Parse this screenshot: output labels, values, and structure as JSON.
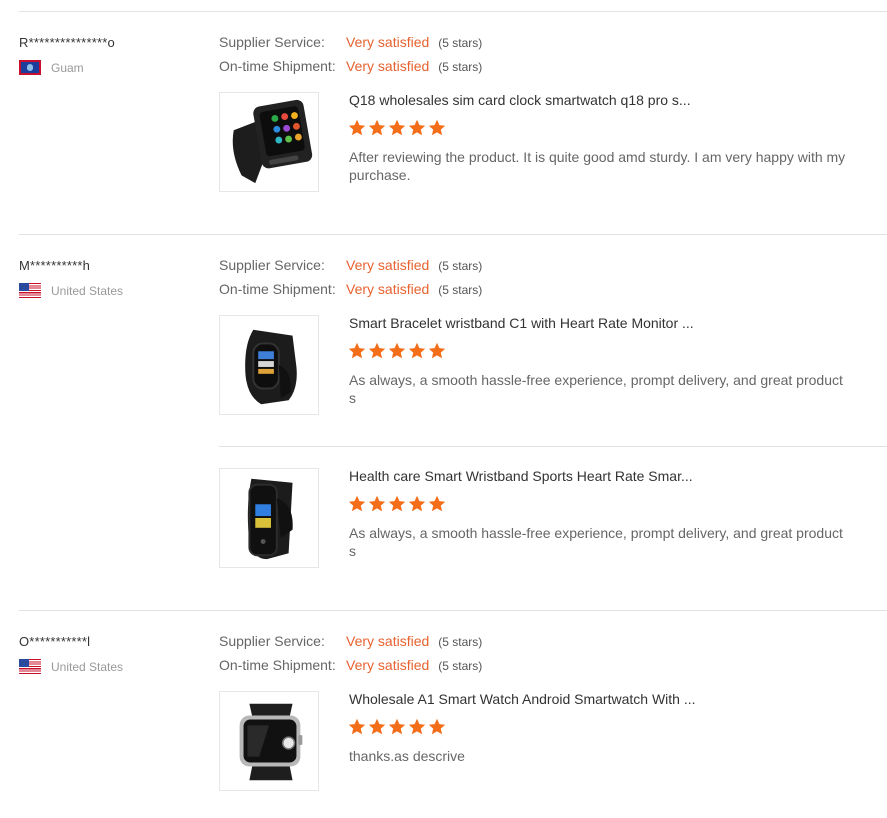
{
  "colors": {
    "accent": "#e8622f",
    "star": "#f46e1a",
    "divider": "#e2e2e2"
  },
  "labels": {
    "supplier_service": "Supplier Service:",
    "ontime_shipment": "On-time Shipment:"
  },
  "reviews": [
    {
      "buyer": "R***************o",
      "country": "Guam",
      "flag_icon": "guam-flag-icon",
      "supplier_service": {
        "value": "Very satisfied",
        "stars_text": "(5 stars)"
      },
      "ontime_shipment": {
        "value": "Very satisfied",
        "stars_text": "(5 stars)"
      },
      "items": [
        {
          "product_icon": "square-smartwatch-image",
          "title": "Q18 wholesales sim card clock smartwatch q18 pro s...",
          "rating": 5,
          "text": "After reviewing the product. It is quite good amd sturdy. I am very happy with my purchase."
        }
      ]
    },
    {
      "buyer": "M**********h",
      "country": "United States",
      "flag_icon": "us-flag-icon",
      "supplier_service": {
        "value": "Very satisfied",
        "stars_text": "(5 stars)"
      },
      "ontime_shipment": {
        "value": "Very satisfied",
        "stars_text": "(5 stars)"
      },
      "items": [
        {
          "product_icon": "fitness-band-image",
          "title": "Smart Bracelet wristband C1 with Heart Rate Monitor ...",
          "rating": 5,
          "text": "As always, a smooth hassle-free experience, prompt delivery, and great products"
        },
        {
          "product_icon": "fitness-band-image",
          "title": "Health care Smart Wristband Sports Heart Rate Smar...",
          "rating": 5,
          "text": "As always, a smooth hassle-free experience, prompt delivery, and great products"
        }
      ]
    },
    {
      "buyer": "O***********l",
      "country": "United States",
      "flag_icon": "us-flag-icon",
      "supplier_service": {
        "value": "Very satisfied",
        "stars_text": "(5 stars)"
      },
      "ontime_shipment": {
        "value": "Very satisfied",
        "stars_text": "(5 stars)"
      },
      "items": [
        {
          "product_icon": "a1-smartwatch-image",
          "title": "Wholesale A1 Smart Watch Android Smartwatch With ...",
          "rating": 5,
          "text": "thanks.as descrive"
        }
      ]
    }
  ]
}
